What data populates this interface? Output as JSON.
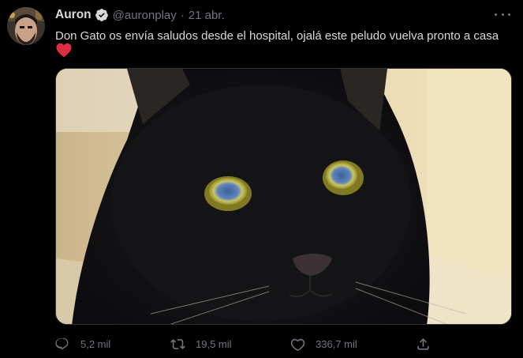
{
  "author": {
    "name": "Auron",
    "handle": "@auronplay",
    "separator": "·",
    "date": "21 abr."
  },
  "tweet": {
    "text": "Don Gato os envía saludos desde el hospital, ojalá este peludo vuelva pronto a casa",
    "emoji": "red-heart"
  },
  "actions": {
    "replies": "5,2 mil",
    "retweets": "19,5 mil",
    "likes": "336,7 mil"
  },
  "colors": {
    "background": "#000000",
    "text": "#d9d9d9",
    "muted": "#6e767d",
    "verified": "#d9d9d9",
    "heart": "#e0245e"
  },
  "icons": [
    "more-icon",
    "verified-badge-icon",
    "reply-icon",
    "retweet-icon",
    "like-icon",
    "share-icon"
  ]
}
